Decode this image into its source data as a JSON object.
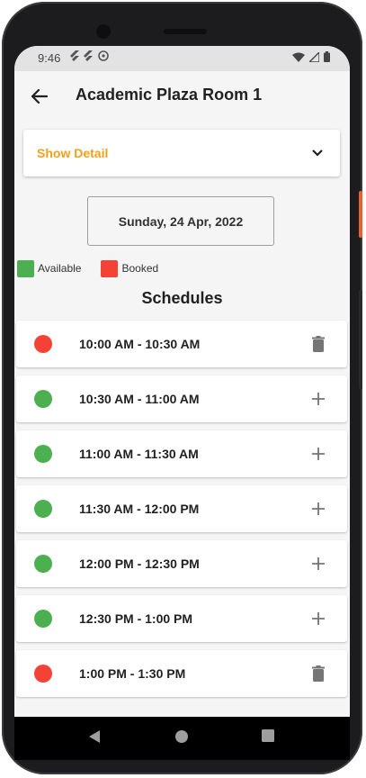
{
  "status": {
    "time": "9:46"
  },
  "appbar": {
    "title": "Academic Plaza Room 1"
  },
  "detail": {
    "label": "Show Detail"
  },
  "date": {
    "label": "Sunday, 24 Apr, 2022"
  },
  "legend": {
    "available": {
      "label": "Available",
      "color": "#4caf50"
    },
    "booked": {
      "label": "Booked",
      "color": "#f44336"
    }
  },
  "schedules": {
    "title": "Schedules",
    "slots": [
      {
        "time": "10:00 AM - 10:30 AM",
        "status": "booked",
        "action": "delete-icon"
      },
      {
        "time": "10:30 AM - 11:00 AM",
        "status": "available",
        "action": "add-icon"
      },
      {
        "time": "11:00 AM - 11:30 AM",
        "status": "available",
        "action": "add-icon"
      },
      {
        "time": "11:30 AM - 12:00 PM",
        "status": "available",
        "action": "add-icon"
      },
      {
        "time": "12:00 PM - 12:30 PM",
        "status": "available",
        "action": "add-icon"
      },
      {
        "time": "12:30 PM - 1:00 PM",
        "status": "available",
        "action": "add-icon"
      },
      {
        "time": "1:00 PM - 1:30 PM",
        "status": "booked",
        "action": "delete-icon"
      }
    ]
  },
  "colors": {
    "accent": "#f4a01a",
    "available": "#4caf50",
    "booked": "#f44336",
    "icon": "#757575"
  }
}
